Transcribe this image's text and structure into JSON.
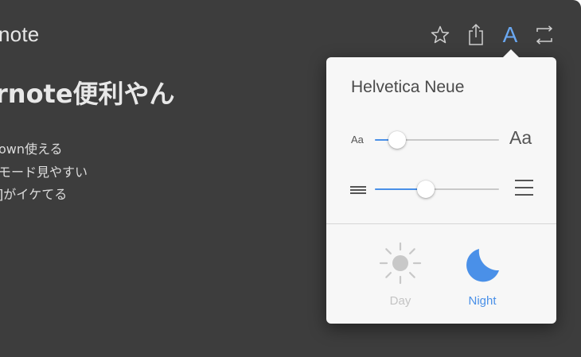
{
  "document": {
    "title": "note",
    "heading": "rnote便利やん",
    "lines": [
      "own使える",
      "モード見やすい",
      "]がイケてる"
    ]
  },
  "toolbar": {
    "icons": [
      "star-icon",
      "share-icon",
      "font-a-icon",
      "fullscreen-icon"
    ],
    "font_button_label": "A"
  },
  "popover": {
    "font_name": "Helvetica Neue",
    "text_size": {
      "small_label": "Aa",
      "large_label": "Aa",
      "value": 0.18
    },
    "line_spacing": {
      "value": 0.41
    },
    "themes": {
      "day_label": "Day",
      "night_label": "Night",
      "selected": "night"
    }
  },
  "colors": {
    "background": "#3d3d3d",
    "popover": "#f7f7f7",
    "accent": "#4a90e8",
    "disabled": "#c4c4c4"
  }
}
